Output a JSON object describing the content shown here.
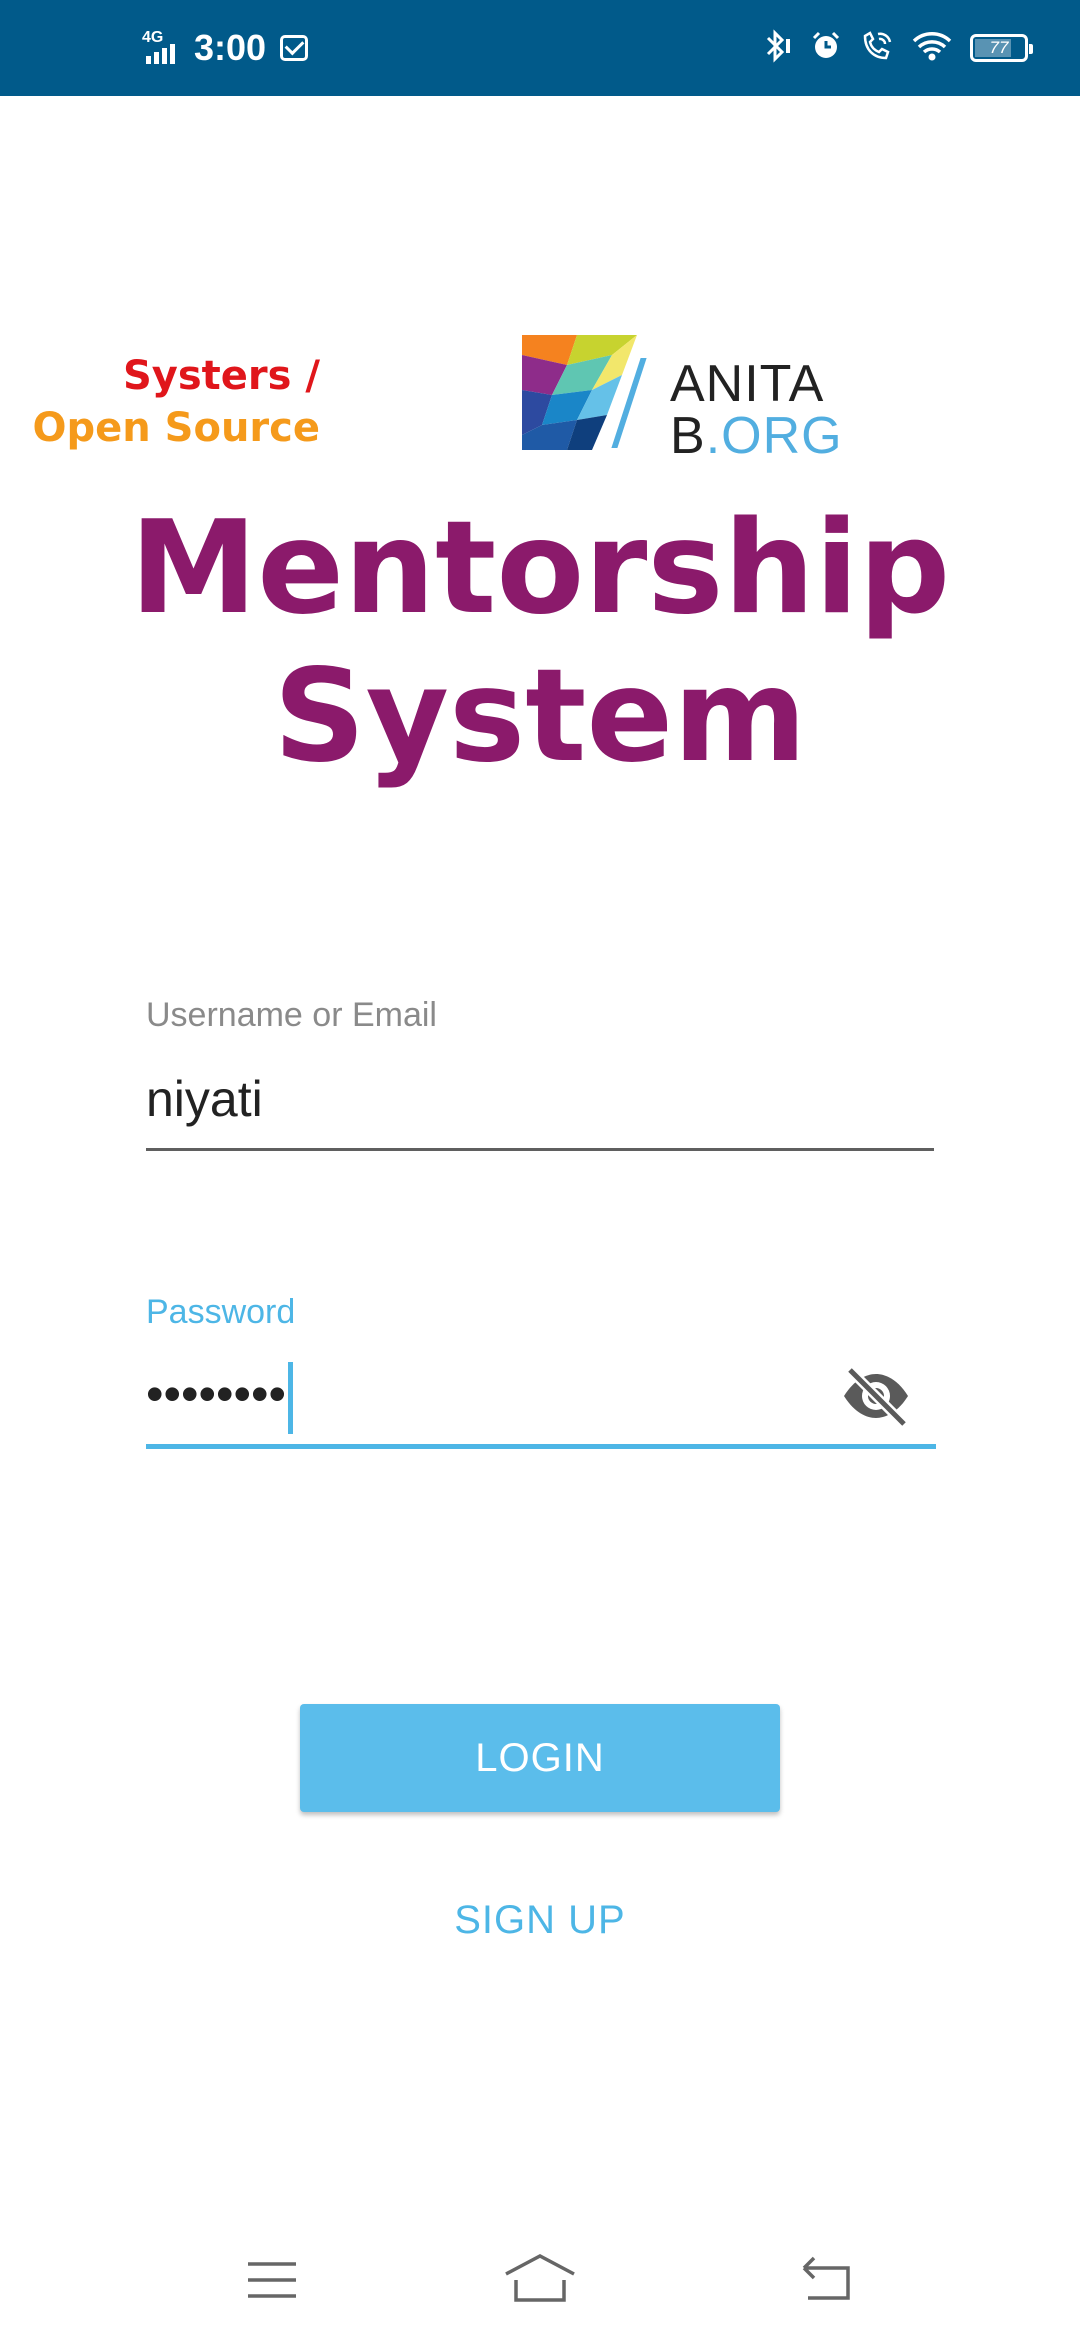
{
  "status_bar": {
    "network": "4G",
    "time": "3:00",
    "battery": "77",
    "battery_level": 0.77,
    "icons": [
      "bluetooth-icon",
      "alarm-icon",
      "wifi-calling-icon",
      "wifi-icon",
      "battery-icon",
      "mail-icon",
      "signal-icon"
    ]
  },
  "logo": {
    "systers_line1": "Systers /",
    "systers_line2": "Open Source",
    "anita_line1": "ANITA",
    "anita_b": "B",
    "anita_org": ".ORG"
  },
  "title": {
    "line1": "Mentorship",
    "line2": "System"
  },
  "form": {
    "username_label": "Username or Email",
    "username_value": "niyati",
    "password_label": "Password",
    "password_value": "••••••••"
  },
  "actions": {
    "login": "LOGIN",
    "signup": "SIGN UP"
  },
  "colors": {
    "status_bar": "#015a8a",
    "title": "#8b1a6b",
    "accent": "#4db6e6",
    "button": "#5bbdeb"
  }
}
